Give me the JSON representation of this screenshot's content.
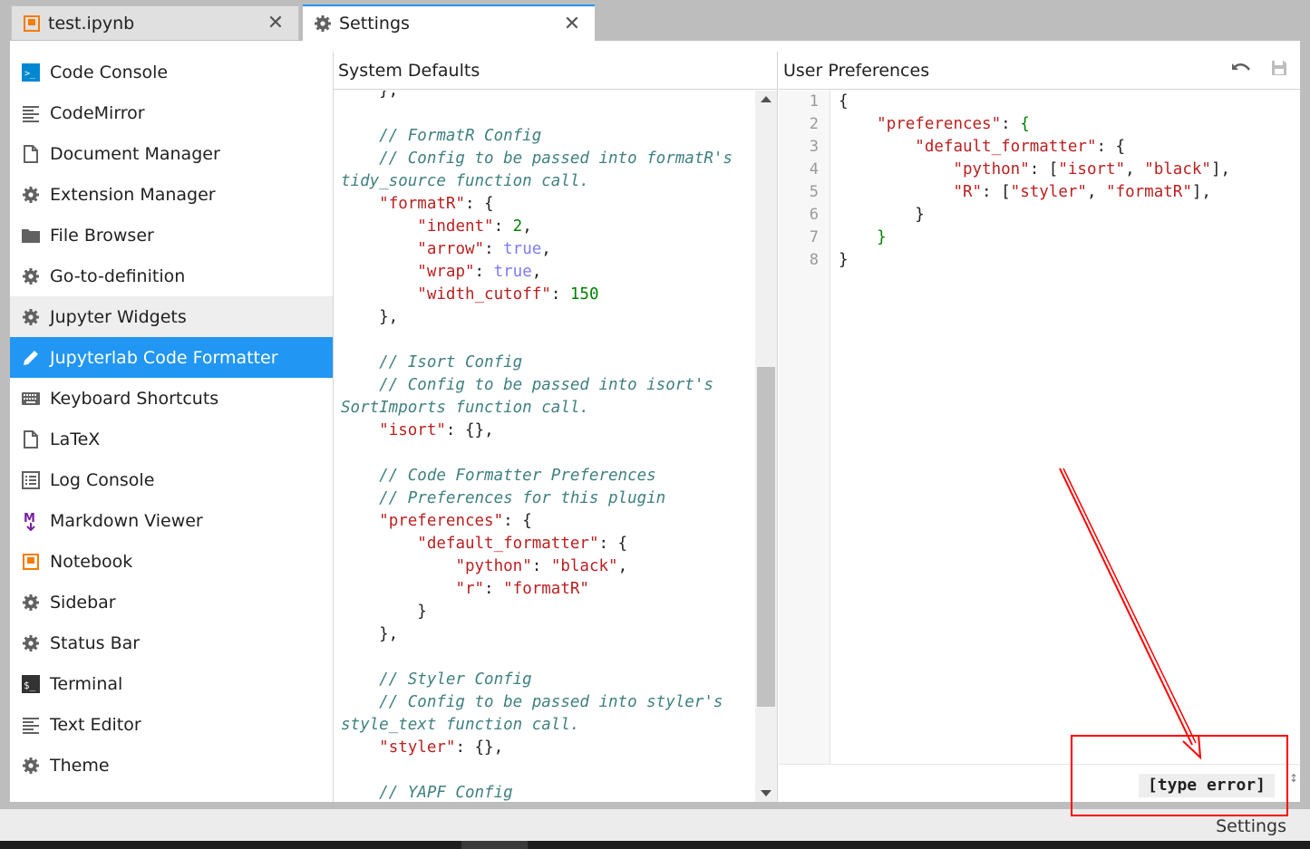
{
  "tabs": [
    {
      "label": "test.ipynb",
      "icon": "notebook-icon",
      "close": "✕"
    },
    {
      "label": "Settings",
      "icon": "gear-icon",
      "close": "✕"
    }
  ],
  "sidebar": {
    "items": [
      {
        "label": "Code Console",
        "icon": "console-icon"
      },
      {
        "label": "CodeMirror",
        "icon": "text-lines-icon"
      },
      {
        "label": "Document Manager",
        "icon": "document-icon"
      },
      {
        "label": "Extension Manager",
        "icon": "gear-icon"
      },
      {
        "label": "File Browser",
        "icon": "folder-icon"
      },
      {
        "label": "Go-to-definition",
        "icon": "gear-icon"
      },
      {
        "label": "Jupyter Widgets",
        "icon": "gear-icon"
      },
      {
        "label": "Jupyterlab Code Formatter",
        "icon": "pencil-icon"
      },
      {
        "label": "Keyboard Shortcuts",
        "icon": "keyboard-icon"
      },
      {
        "label": "LaTeX",
        "icon": "document-icon"
      },
      {
        "label": "Log Console",
        "icon": "list-icon"
      },
      {
        "label": "Markdown Viewer",
        "icon": "markdown-icon"
      },
      {
        "label": "Notebook",
        "icon": "notebook-icon"
      },
      {
        "label": "Sidebar",
        "icon": "gear-icon"
      },
      {
        "label": "Status Bar",
        "icon": "gear-icon"
      },
      {
        "label": "Terminal",
        "icon": "terminal-icon"
      },
      {
        "label": "Text Editor",
        "icon": "text-lines-icon"
      },
      {
        "label": "Theme",
        "icon": "gear-icon"
      }
    ],
    "hover_index": 6,
    "active_index": 7
  },
  "system_defaults": {
    "title": "System Defaults"
  },
  "user_preferences": {
    "title": "User Preferences",
    "line_numbers": [
      "1",
      "2",
      "3",
      "4",
      "5",
      "6",
      "7",
      "8"
    ],
    "error_label": "[type error]"
  },
  "status_bar": {
    "label": "Settings"
  },
  "colors": {
    "accent": "#2196f3",
    "annotation": "#ff0000",
    "string": "#ba2121",
    "comment": "#408080",
    "number": "#008000",
    "keyword": "#7c7cf4"
  }
}
